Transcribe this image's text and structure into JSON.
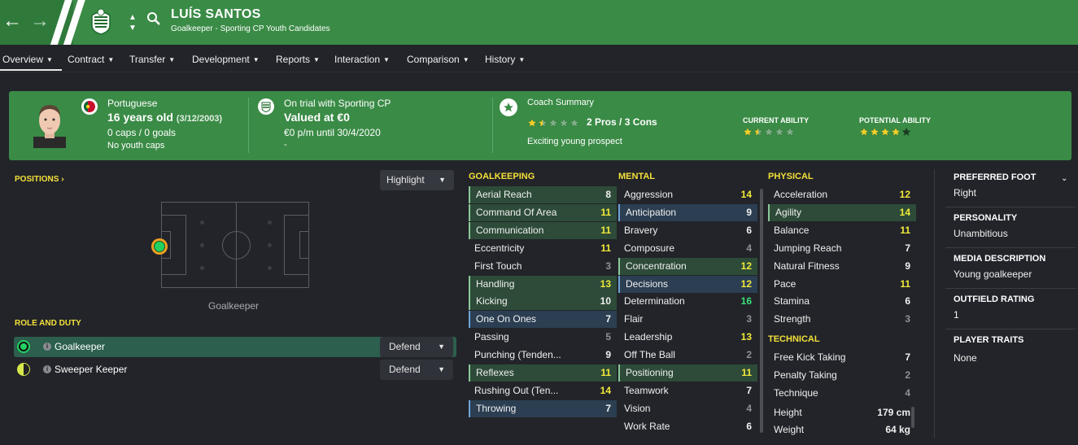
{
  "header": {
    "player_name": "LUÍS SANTOS",
    "subtitle": "Goalkeeper - Sporting CP Youth Candidates",
    "back_icon": "arrow-left-icon",
    "forward_icon": "arrow-right-icon",
    "brand_color": "#3a8b46"
  },
  "tabs": [
    {
      "label": "Overview"
    },
    {
      "label": "Contract"
    },
    {
      "label": "Transfer"
    },
    {
      "label": "Development"
    },
    {
      "label": "Reports"
    },
    {
      "label": "Interaction"
    },
    {
      "label": "Comparison"
    },
    {
      "label": "History"
    }
  ],
  "summary": {
    "nationality": "Portuguese",
    "age": "16 years old",
    "dob": "(3/12/2003)",
    "caps": "0 caps / 0 goals",
    "youth_caps": "No youth caps",
    "club_status": "On trial with Sporting CP",
    "value": "Valued at €0",
    "wage": "€0 p/m until 30/4/2020",
    "dash": "-",
    "coach_title": "Coach Summary",
    "pros_cons": "2 Pros / 3 Cons",
    "coach_note": "Exciting young prospect",
    "coach_stars": 1.5,
    "current_ability_label": "CURRENT ABILITY",
    "current_ability_stars": 1.5,
    "potential_ability_label": "POTENTIAL ABILITY",
    "potential_ability_stars": 4
  },
  "positions": {
    "heading": "POSITIONS",
    "highlight_label": "Highlight",
    "pitch_label": "Goalkeeper"
  },
  "roles": {
    "heading": "ROLE AND DUTY",
    "items": [
      {
        "name": "Goalkeeper",
        "duty": "Defend"
      },
      {
        "name": "Sweeper Keeper",
        "duty": "Defend"
      }
    ]
  },
  "goalkeeping": {
    "heading": "GOALKEEPING",
    "attrs": [
      {
        "name": "Aerial Reach",
        "value": "8",
        "style": "hl",
        "color": ""
      },
      {
        "name": "Command Of Area",
        "value": "11",
        "style": "hl",
        "color": "y"
      },
      {
        "name": "Communication",
        "value": "11",
        "style": "hl",
        "color": "y"
      },
      {
        "name": "Eccentricity",
        "value": "11",
        "style": "",
        "color": "y"
      },
      {
        "name": "First Touch",
        "value": "3",
        "style": "",
        "color": "d"
      },
      {
        "name": "Handling",
        "value": "13",
        "style": "hl",
        "color": "y"
      },
      {
        "name": "Kicking",
        "value": "10",
        "style": "hl",
        "color": ""
      },
      {
        "name": "One On Ones",
        "value": "7",
        "style": "bl",
        "color": ""
      },
      {
        "name": "Passing",
        "value": "5",
        "style": "",
        "color": "d"
      },
      {
        "name": "Punching (Tenden...",
        "value": "9",
        "style": "",
        "color": ""
      },
      {
        "name": "Reflexes",
        "value": "11",
        "style": "hl",
        "color": "y"
      },
      {
        "name": "Rushing Out (Ten...",
        "value": "14",
        "style": "",
        "color": "y"
      },
      {
        "name": "Throwing",
        "value": "7",
        "style": "bl",
        "color": ""
      }
    ]
  },
  "mental": {
    "heading": "MENTAL",
    "attrs": [
      {
        "name": "Aggression",
        "value": "14",
        "style": "",
        "color": "y"
      },
      {
        "name": "Anticipation",
        "value": "9",
        "style": "bl",
        "color": ""
      },
      {
        "name": "Bravery",
        "value": "6",
        "style": "",
        "color": ""
      },
      {
        "name": "Composure",
        "value": "4",
        "style": "",
        "color": "d"
      },
      {
        "name": "Concentration",
        "value": "12",
        "style": "hl",
        "color": "y"
      },
      {
        "name": "Decisions",
        "value": "12",
        "style": "bl",
        "color": "y"
      },
      {
        "name": "Determination",
        "value": "16",
        "style": "",
        "color": "g"
      },
      {
        "name": "Flair",
        "value": "3",
        "style": "",
        "color": "d"
      },
      {
        "name": "Leadership",
        "value": "13",
        "style": "",
        "color": "y"
      },
      {
        "name": "Off The Ball",
        "value": "2",
        "style": "",
        "color": "d"
      },
      {
        "name": "Positioning",
        "value": "11",
        "style": "hl",
        "color": "y"
      },
      {
        "name": "Teamwork",
        "value": "7",
        "style": "",
        "color": ""
      },
      {
        "name": "Vision",
        "value": "4",
        "style": "",
        "color": "d"
      },
      {
        "name": "Work Rate",
        "value": "6",
        "style": "",
        "color": ""
      }
    ]
  },
  "physical": {
    "heading": "PHYSICAL",
    "attrs": [
      {
        "name": "Acceleration",
        "value": "12",
        "style": "",
        "color": "y"
      },
      {
        "name": "Agility",
        "value": "14",
        "style": "hl",
        "color": "y"
      },
      {
        "name": "Balance",
        "value": "11",
        "style": "",
        "color": "y"
      },
      {
        "name": "Jumping Reach",
        "value": "7",
        "style": "",
        "color": ""
      },
      {
        "name": "Natural Fitness",
        "value": "9",
        "style": "",
        "color": ""
      },
      {
        "name": "Pace",
        "value": "11",
        "style": "",
        "color": "y"
      },
      {
        "name": "Stamina",
        "value": "6",
        "style": "",
        "color": ""
      },
      {
        "name": "Strength",
        "value": "3",
        "style": "",
        "color": "d"
      }
    ]
  },
  "technical": {
    "heading": "TECHNICAL",
    "attrs": [
      {
        "name": "Free Kick Taking",
        "value": "7",
        "style": "",
        "color": ""
      },
      {
        "name": "Penalty Taking",
        "value": "2",
        "style": "",
        "color": "d"
      },
      {
        "name": "Technique",
        "value": "4",
        "style": "",
        "color": "d"
      }
    ]
  },
  "measures": [
    {
      "name": "Height",
      "value": "179 cm"
    },
    {
      "name": "Weight",
      "value": "64 kg"
    }
  ],
  "side": {
    "preferred_foot_label": "PREFERRED FOOT",
    "preferred_foot": "Right",
    "personality_label": "PERSONALITY",
    "personality": "Unambitious",
    "media_label": "MEDIA DESCRIPTION",
    "media": "Young goalkeeper",
    "outfield_label": "OUTFIELD RATING",
    "outfield": "1",
    "traits_label": "PLAYER TRAITS",
    "traits": "None"
  }
}
